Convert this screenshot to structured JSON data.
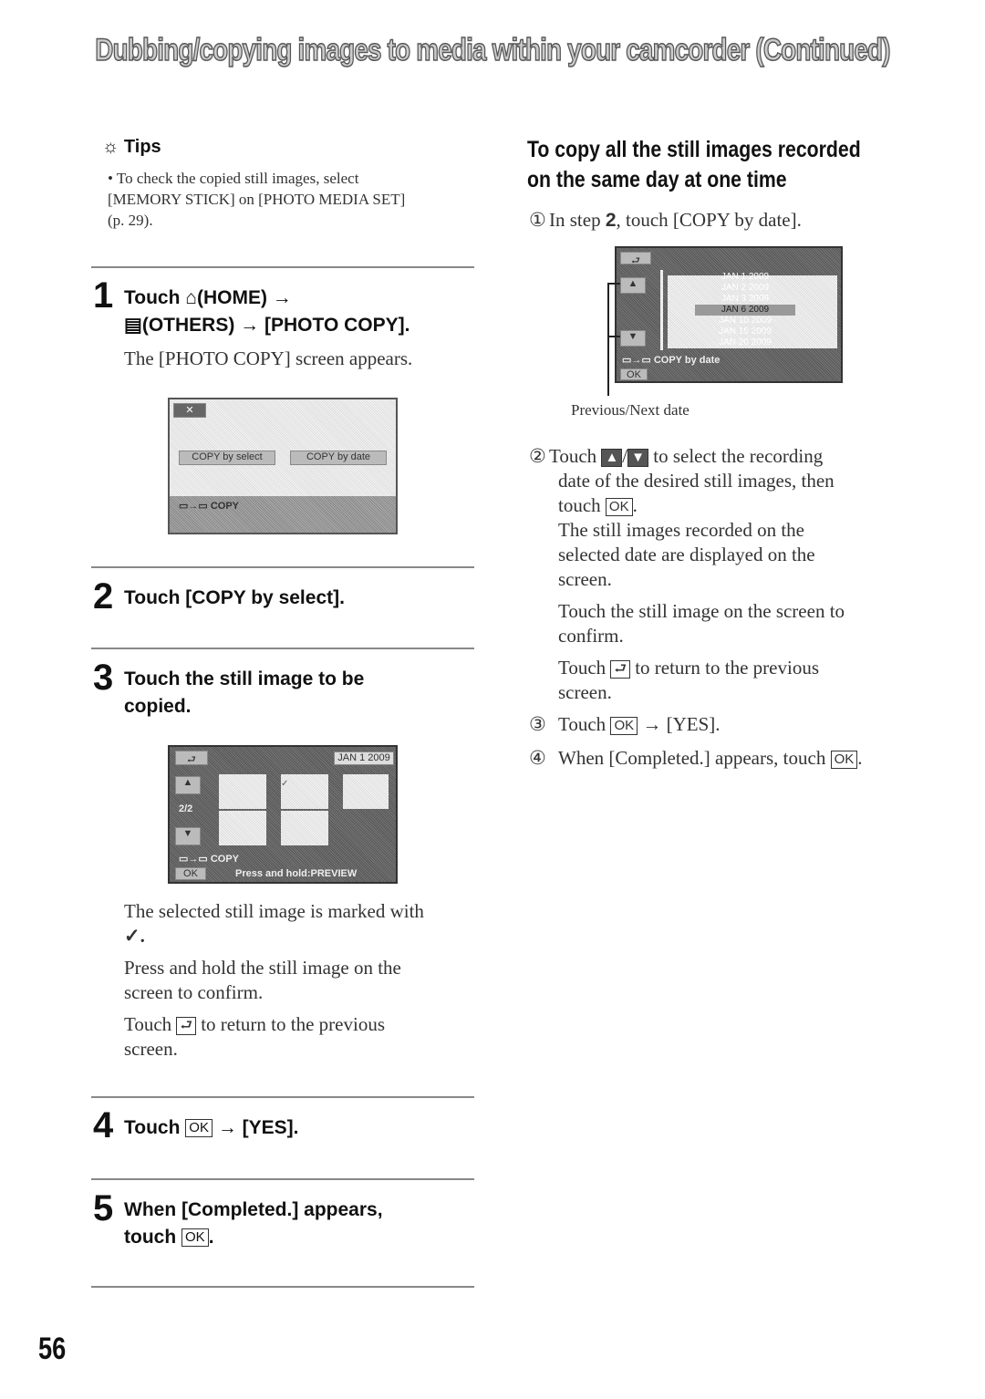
{
  "header": {
    "title": "Dubbing/copying images to media within your camcorder (Continued)"
  },
  "tips": {
    "icon": "lightbulb-icon",
    "heading": "Tips",
    "lines": [
      "• To check the copied still images, select",
      "[MEMORY STICK] on [PHOTO MEDIA SET]",
      "(p. 29)."
    ]
  },
  "steps": [
    {
      "num": "1",
      "line1a": "Touch",
      "line1b": "(HOME) →",
      "line2": "(OTHERS) → [PHOTO COPY].",
      "body": "The [PHOTO COPY] screen appears."
    },
    {
      "num": "2",
      "line1": "Touch [COPY by select]."
    },
    {
      "num": "3",
      "line1": "Touch the still image to be",
      "line2": "copied.",
      "body": [
        "The selected still image is marked with",
        "✓.",
        "Press and hold the still image on the",
        "screen to confirm.",
        "Touch",
        "to return to the previous",
        "screen."
      ]
    },
    {
      "num": "4",
      "line1a": "Touch",
      "line1b": "→ [YES]."
    },
    {
      "num": "5",
      "line1": "When [Completed.] appears,",
      "line2a": "touch",
      "line2b": "."
    }
  ],
  "screen1": {
    "close": "✕",
    "btn1": "COPY by select",
    "btn2": "COPY by date",
    "label": "COPY"
  },
  "screen2": {
    "date": "JAN 1 2009",
    "page": "2/2",
    "label": "COPY",
    "ok": "OK",
    "hint": "Press and hold:PREVIEW"
  },
  "right": {
    "heading1": "To copy all the still images recorded",
    "heading2": "on the same day at one time",
    "step1": {
      "num": "①",
      "a": "In step",
      "b": "2",
      "c": ", touch [COPY by date]."
    },
    "screen": {
      "dates": [
        "JAN 1 2009",
        "JAN 2 2009",
        "JAN 3 2009",
        "JAN 6 2009",
        "JAN 10 2009",
        "JAN 15 2009",
        "JAN 20 2009"
      ],
      "label": "COPY by date",
      "ok": "OK"
    },
    "caption": "Previous/Next date",
    "step2": {
      "num": "②",
      "lines": [
        "Touch",
        "to select the recording",
        "date of the desired still images, then",
        "touch",
        ".",
        "The still images recorded on the",
        "selected date are displayed on the",
        "screen.",
        "Touch the still image on the screen to",
        "confirm.",
        "Touch",
        "to return to the previous",
        "screen."
      ]
    },
    "step3": {
      "num": "③",
      "a": "Touch",
      "b": "→ [YES]."
    },
    "step4": {
      "num": "④",
      "a": "When [Completed.] appears, touch",
      "b": "."
    }
  },
  "ok_label": "OK",
  "page_number": "56"
}
